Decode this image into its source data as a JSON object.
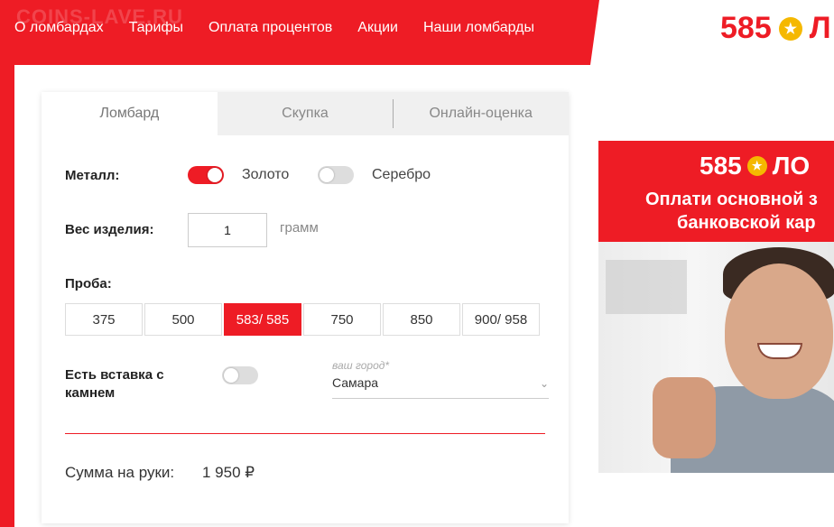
{
  "watermark": "COINS-LAVE.RU",
  "nav": {
    "items": [
      "О ломбардах",
      "Тарифы",
      "Оплата процентов",
      "Акции",
      "Наши ломбарды"
    ]
  },
  "logo": {
    "text": "585",
    "partial": "Л"
  },
  "tabs": [
    "Ломбард",
    "Скупка",
    "Онлайн-оценка"
  ],
  "metal": {
    "label": "Металл:",
    "gold": "Золото",
    "silver": "Серебро",
    "gold_on": true,
    "silver_on": false
  },
  "weight": {
    "label": "Вес изделия:",
    "value": "1",
    "unit": "грамм"
  },
  "assay": {
    "label": "Проба:",
    "options": [
      "375",
      "500",
      "583/ 585",
      "750",
      "850",
      "900/ 958"
    ],
    "selected": "583/ 585"
  },
  "stone": {
    "label": "Есть вставка с камнем",
    "on": false
  },
  "city": {
    "placeholder": "ваш город*",
    "value": "Самара"
  },
  "sum": {
    "label": "Сумма на руки:",
    "value": "1 950 ₽"
  },
  "banner": {
    "logo": "585",
    "logo_partial": "ЛО",
    "line1": "Оплати основной з",
    "line2": "банковской кар"
  },
  "colors": {
    "accent": "#ee1c25",
    "star": "#f5b800"
  },
  "icons": {
    "star": "star-icon",
    "chevron": "chevron-down-icon"
  }
}
